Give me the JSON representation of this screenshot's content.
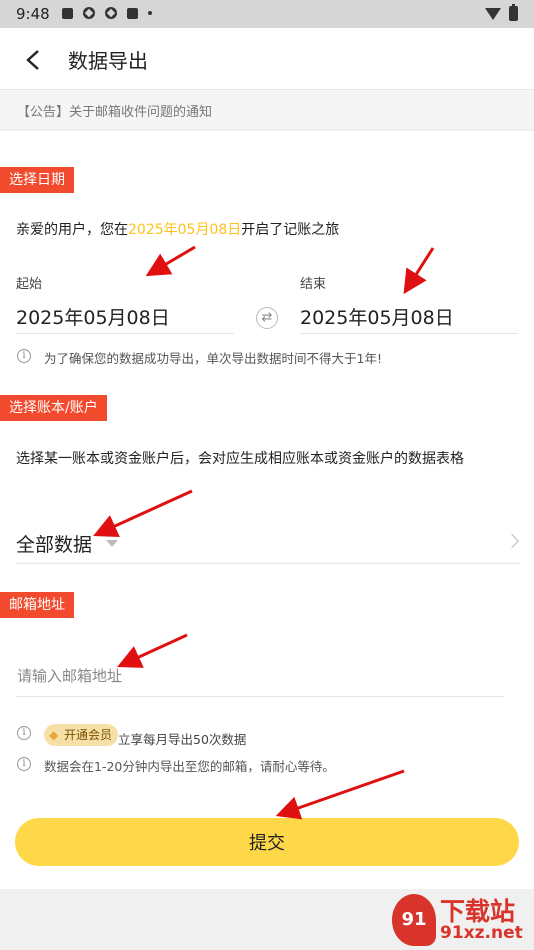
{
  "status_bar": {
    "time": "9:48"
  },
  "header": {
    "title": "数据导出"
  },
  "notice": "【公告】关于邮箱收件问题的通知",
  "date_section": {
    "tag": "选择日期",
    "intro_prefix": "亲爱的用户，您在",
    "intro_date": "2025年05月08日",
    "intro_suffix": "开启了记账之旅",
    "start_label": "起始",
    "start_value": "2025年05月08日",
    "end_label": "结束",
    "end_value": "2025年05月08日",
    "swap_icon": "swap-icon",
    "hint": "为了确保您的数据成功导出，单次导出数据时间不得大于1年!"
  },
  "book_section": {
    "tag": "选择账本/账户",
    "desc": "选择某一账本或资金账户后，会对应生成相应账本或资金账户的数据表格",
    "selected": "全部数据"
  },
  "email_section": {
    "tag": "邮箱地址",
    "placeholder": "请输入邮箱地址",
    "value": ""
  },
  "tips": {
    "vip_badge": "开通会员",
    "vip_text": "立享每月导出50次数据",
    "delivery": "数据会在1-20分钟内导出至您的邮箱，请耐心等待。"
  },
  "submit_label": "提交",
  "watermark": {
    "logo": "91",
    "text": "下载站",
    "url": "91xz.net"
  },
  "colors": {
    "accent": "#ffd84a",
    "tag_red": "#f24a2c",
    "highlight": "#ffc21a",
    "arrow": "#e01010"
  }
}
